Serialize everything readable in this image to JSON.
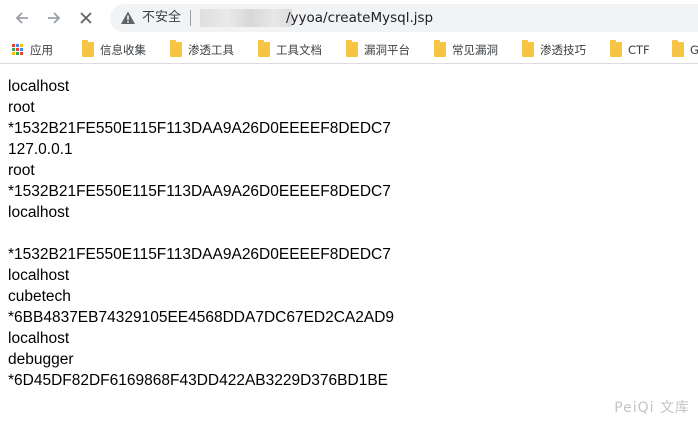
{
  "browser": {
    "security_label": "不安全",
    "url_suffix": "/yyoa/createMysql.jsp"
  },
  "bookmarks": [
    {
      "label": "应用",
      "icon": "apps-grid-icon"
    },
    {
      "label": "信息收集",
      "icon": "folder-icon"
    },
    {
      "label": "渗透工具",
      "icon": "folder-icon"
    },
    {
      "label": "工具文档",
      "icon": "folder-icon"
    },
    {
      "label": "漏洞平台",
      "icon": "folder-icon"
    },
    {
      "label": "常见漏洞",
      "icon": "folder-icon"
    },
    {
      "label": "渗透技巧",
      "icon": "folder-icon"
    },
    {
      "label": "CTF",
      "icon": "folder-icon"
    },
    {
      "label": "G",
      "icon": "folder-icon"
    }
  ],
  "page": {
    "lines": [
      "localhost",
      "root",
      "*1532B21FE550E115F113DAA9A26D0EEEEF8DEDC7",
      "127.0.0.1",
      "root",
      "*1532B21FE550E115F113DAA9A26D0EEEEF8DEDC7",
      "localhost",
      "",
      "*1532B21FE550E115F113DAA9A26D0EEEEF8DEDC7",
      "localhost",
      "cubetech",
      "*6BB4837EB74329105EE4568DDA7DC67ED2CA2AD9",
      "localhost",
      "debugger",
      "*6D45DF82DF6169868F43DD422AB3229D376BD1BE"
    ]
  },
  "watermark": "PeiQi 文库"
}
